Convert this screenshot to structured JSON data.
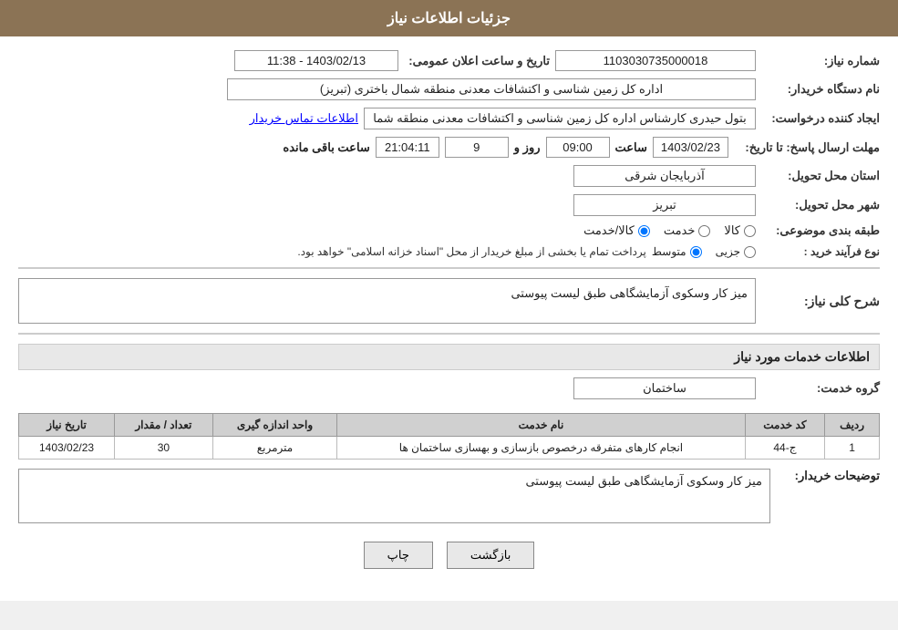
{
  "header": {
    "title": "جزئیات اطلاعات نیاز"
  },
  "need_number": {
    "label": "شماره نیاز:",
    "value": "1103030735000018"
  },
  "announcement_datetime": {
    "label": "تاریخ و ساعت اعلان عمومی:",
    "value": "1403/02/13 - 11:38"
  },
  "buyer_org": {
    "label": "نام دستگاه خریدار:",
    "value": "اداره کل زمین شناسی و اکتشافات معدنی منطقه شمال باختری (تبریز)"
  },
  "creator": {
    "label": "ایجاد کننده درخواست:",
    "value": "بتول حیدری کارشناس اداره کل زمین شناسی و اکتشافات معدنی منطقه شما"
  },
  "creator_link": "اطلاعات تماس خریدار",
  "response_deadline": {
    "label": "مهلت ارسال پاسخ: تا تاریخ:",
    "date": "1403/02/23",
    "time": "09:00",
    "days_remaining_label": "روز و",
    "days_remaining": "9",
    "time_remaining": "21:04:11",
    "remaining_label": "ساعت باقی مانده"
  },
  "province": {
    "label": "استان محل تحویل:",
    "value": "آذربایجان شرقی"
  },
  "city": {
    "label": "شهر محل تحویل:",
    "value": "تبریز"
  },
  "category": {
    "label": "طبقه بندی موضوعی:",
    "options": [
      "کالا",
      "خدمت",
      "کالا/خدمت"
    ],
    "selected": "کالا"
  },
  "procurement_type": {
    "label": "نوع فرآیند خرید :",
    "options": [
      "جزیی",
      "متوسط"
    ],
    "note": "پرداخت تمام یا بخشی از مبلغ خریدار از محل \"اسناد خزانه اسلامی\" خواهد بود."
  },
  "need_description": {
    "section_title": "شرح کلی نیاز:",
    "value": "میز کار وسکوی آزمایشگاهی طبق لیست پیوستی"
  },
  "services_section": {
    "title": "اطلاعات خدمات مورد نیاز"
  },
  "service_group": {
    "label": "گروه خدمت:",
    "value": "ساختمان"
  },
  "table": {
    "columns": [
      "ردیف",
      "کد خدمت",
      "نام خدمت",
      "واحد اندازه گیری",
      "تعداد / مقدار",
      "تاریخ نیاز"
    ],
    "rows": [
      {
        "row": "1",
        "code": "ج-44",
        "name": "انجام کارهای متفرقه درخصوص بازسازی و بهسازی ساختمان ها",
        "unit": "مترمربع",
        "quantity": "30",
        "date": "1403/02/23"
      }
    ]
  },
  "buyer_description": {
    "label": "توضیحات خریدار:",
    "value": "میز کار وسکوی آزمایشگاهی طبق لیست پیوستی"
  },
  "buttons": {
    "print": "چاپ",
    "back": "بازگشت"
  }
}
